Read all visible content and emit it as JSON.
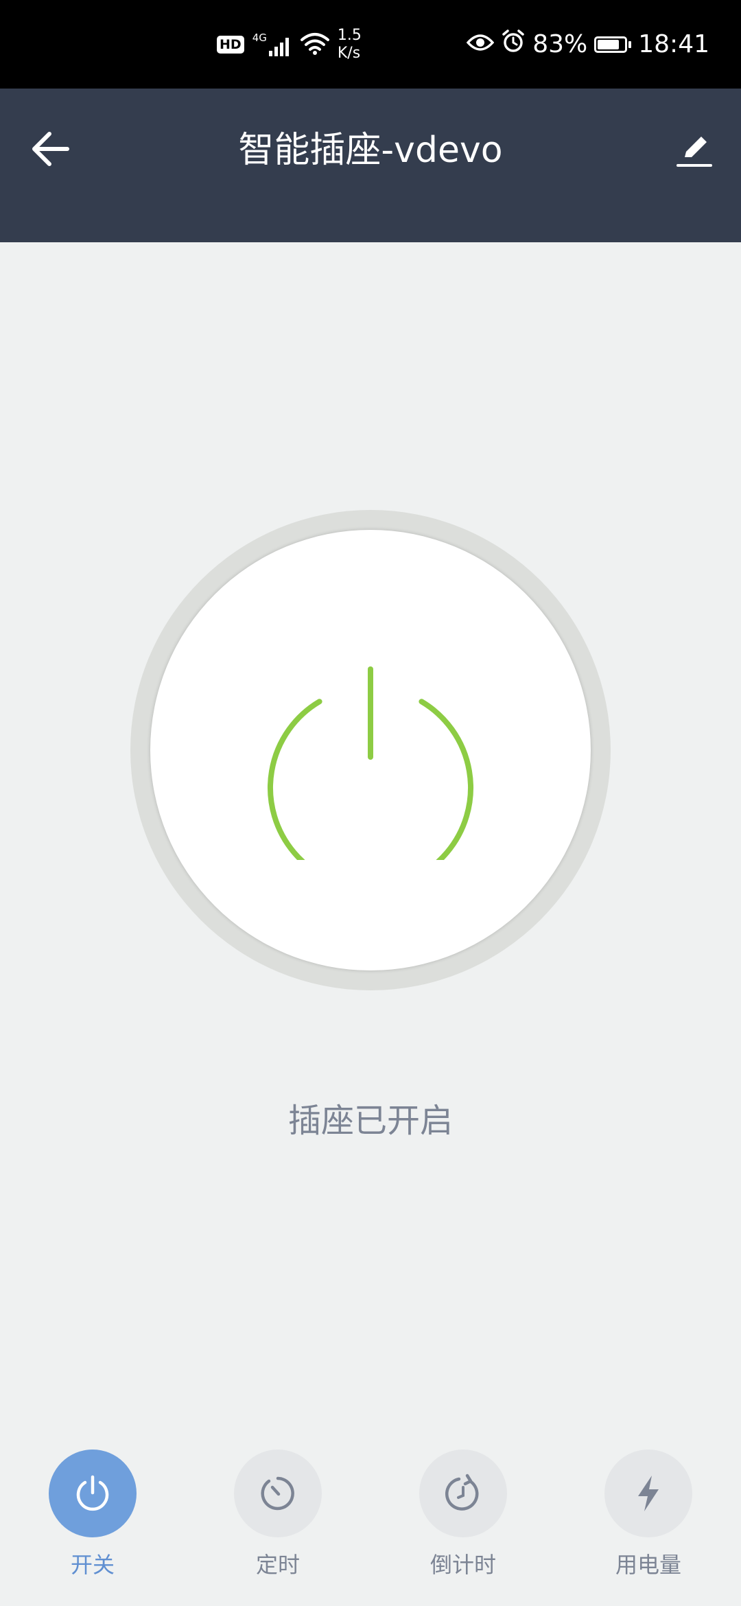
{
  "status_bar": {
    "hd_badge": "HD",
    "network": "4G",
    "speed_value": "1.5",
    "speed_unit": "K/s",
    "battery_percent": "83%",
    "battery_level": 0.83,
    "time": "18:41"
  },
  "header": {
    "title": "智能插座-vdevo"
  },
  "main": {
    "status_text": "插座已开启",
    "power_state": "on",
    "power_color": "#8dcc44"
  },
  "tabs": [
    {
      "label": "开关",
      "icon": "power-icon",
      "active": true
    },
    {
      "label": "定时",
      "icon": "timer-icon",
      "active": false
    },
    {
      "label": "倒计时",
      "icon": "countdown-icon",
      "active": false
    },
    {
      "label": "用电量",
      "icon": "lightning-icon",
      "active": false
    }
  ],
  "colors": {
    "header_bg": "#343d4e",
    "accent": "#6f9fdc",
    "page_bg": "#eff1f1"
  }
}
